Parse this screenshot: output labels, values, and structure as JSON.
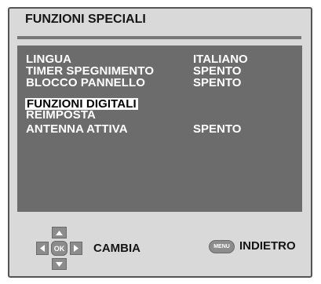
{
  "menu": {
    "title": "FUNZIONI SPECIALI",
    "items": [
      {
        "label": "LINGUA",
        "value": "ITALIANO"
      },
      {
        "label": "TIMER SPEGNIMENTO",
        "value": "SPENTO"
      },
      {
        "label": "BLOCCO PANNELLO",
        "value": "SPENTO"
      },
      {
        "label": "FUNZIONI DIGITALI",
        "value": "",
        "selected": true
      },
      {
        "label": "REIMPOSTA",
        "value": ""
      },
      {
        "label": "ANTENNA ATTIVA",
        "value": "SPENTO"
      }
    ]
  },
  "footer": {
    "ok_key": "OK",
    "change_label": "CAMBIA",
    "menu_key": "MENU",
    "back_label": "INDIETRO"
  },
  "colors": {
    "frame": "#d9d9d9",
    "panel": "#6c6c6c",
    "text_on_panel": "#ffffff",
    "highlight": "#ffffff",
    "key": "#8c8c8c"
  },
  "icons": [
    "dpad-up-icon",
    "dpad-down-icon",
    "dpad-left-icon",
    "dpad-right-icon"
  ]
}
